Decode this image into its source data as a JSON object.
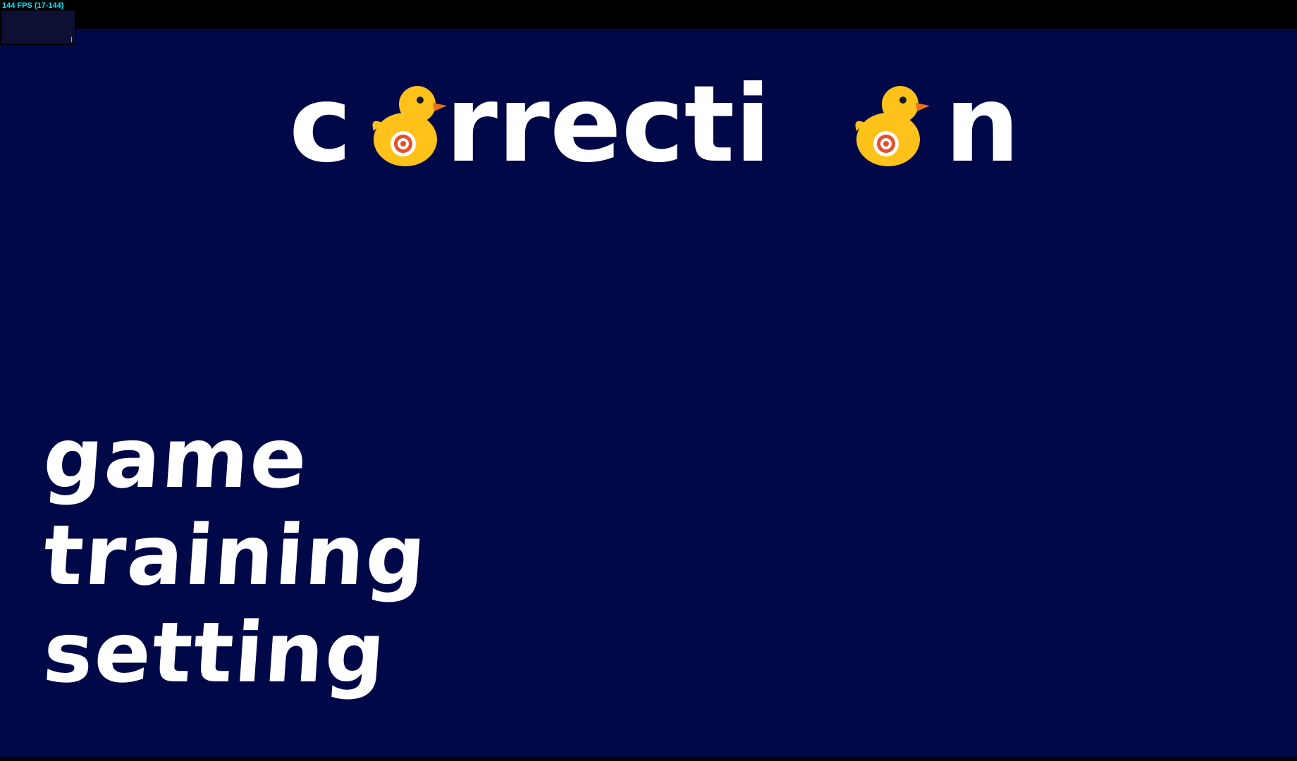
{
  "fps": {
    "label": "144 FPS (17-144)",
    "color": "#00e5ff"
  },
  "title": {
    "text": "correction",
    "letters_before_duck_1": "c",
    "letters_middle": "rrecti",
    "letters_after_duck_2": "n",
    "icons": [
      "rubber-duck-target-icon",
      "rubber-duck-target-icon"
    ],
    "duck_color": "#ffc21a",
    "target_color": "#e8502a"
  },
  "menu": {
    "items": [
      {
        "label": "game"
      },
      {
        "label": "training"
      },
      {
        "label": "setting"
      }
    ]
  },
  "colors": {
    "background": "#000848",
    "letterbox": "#000000",
    "text": "#ffffff"
  }
}
